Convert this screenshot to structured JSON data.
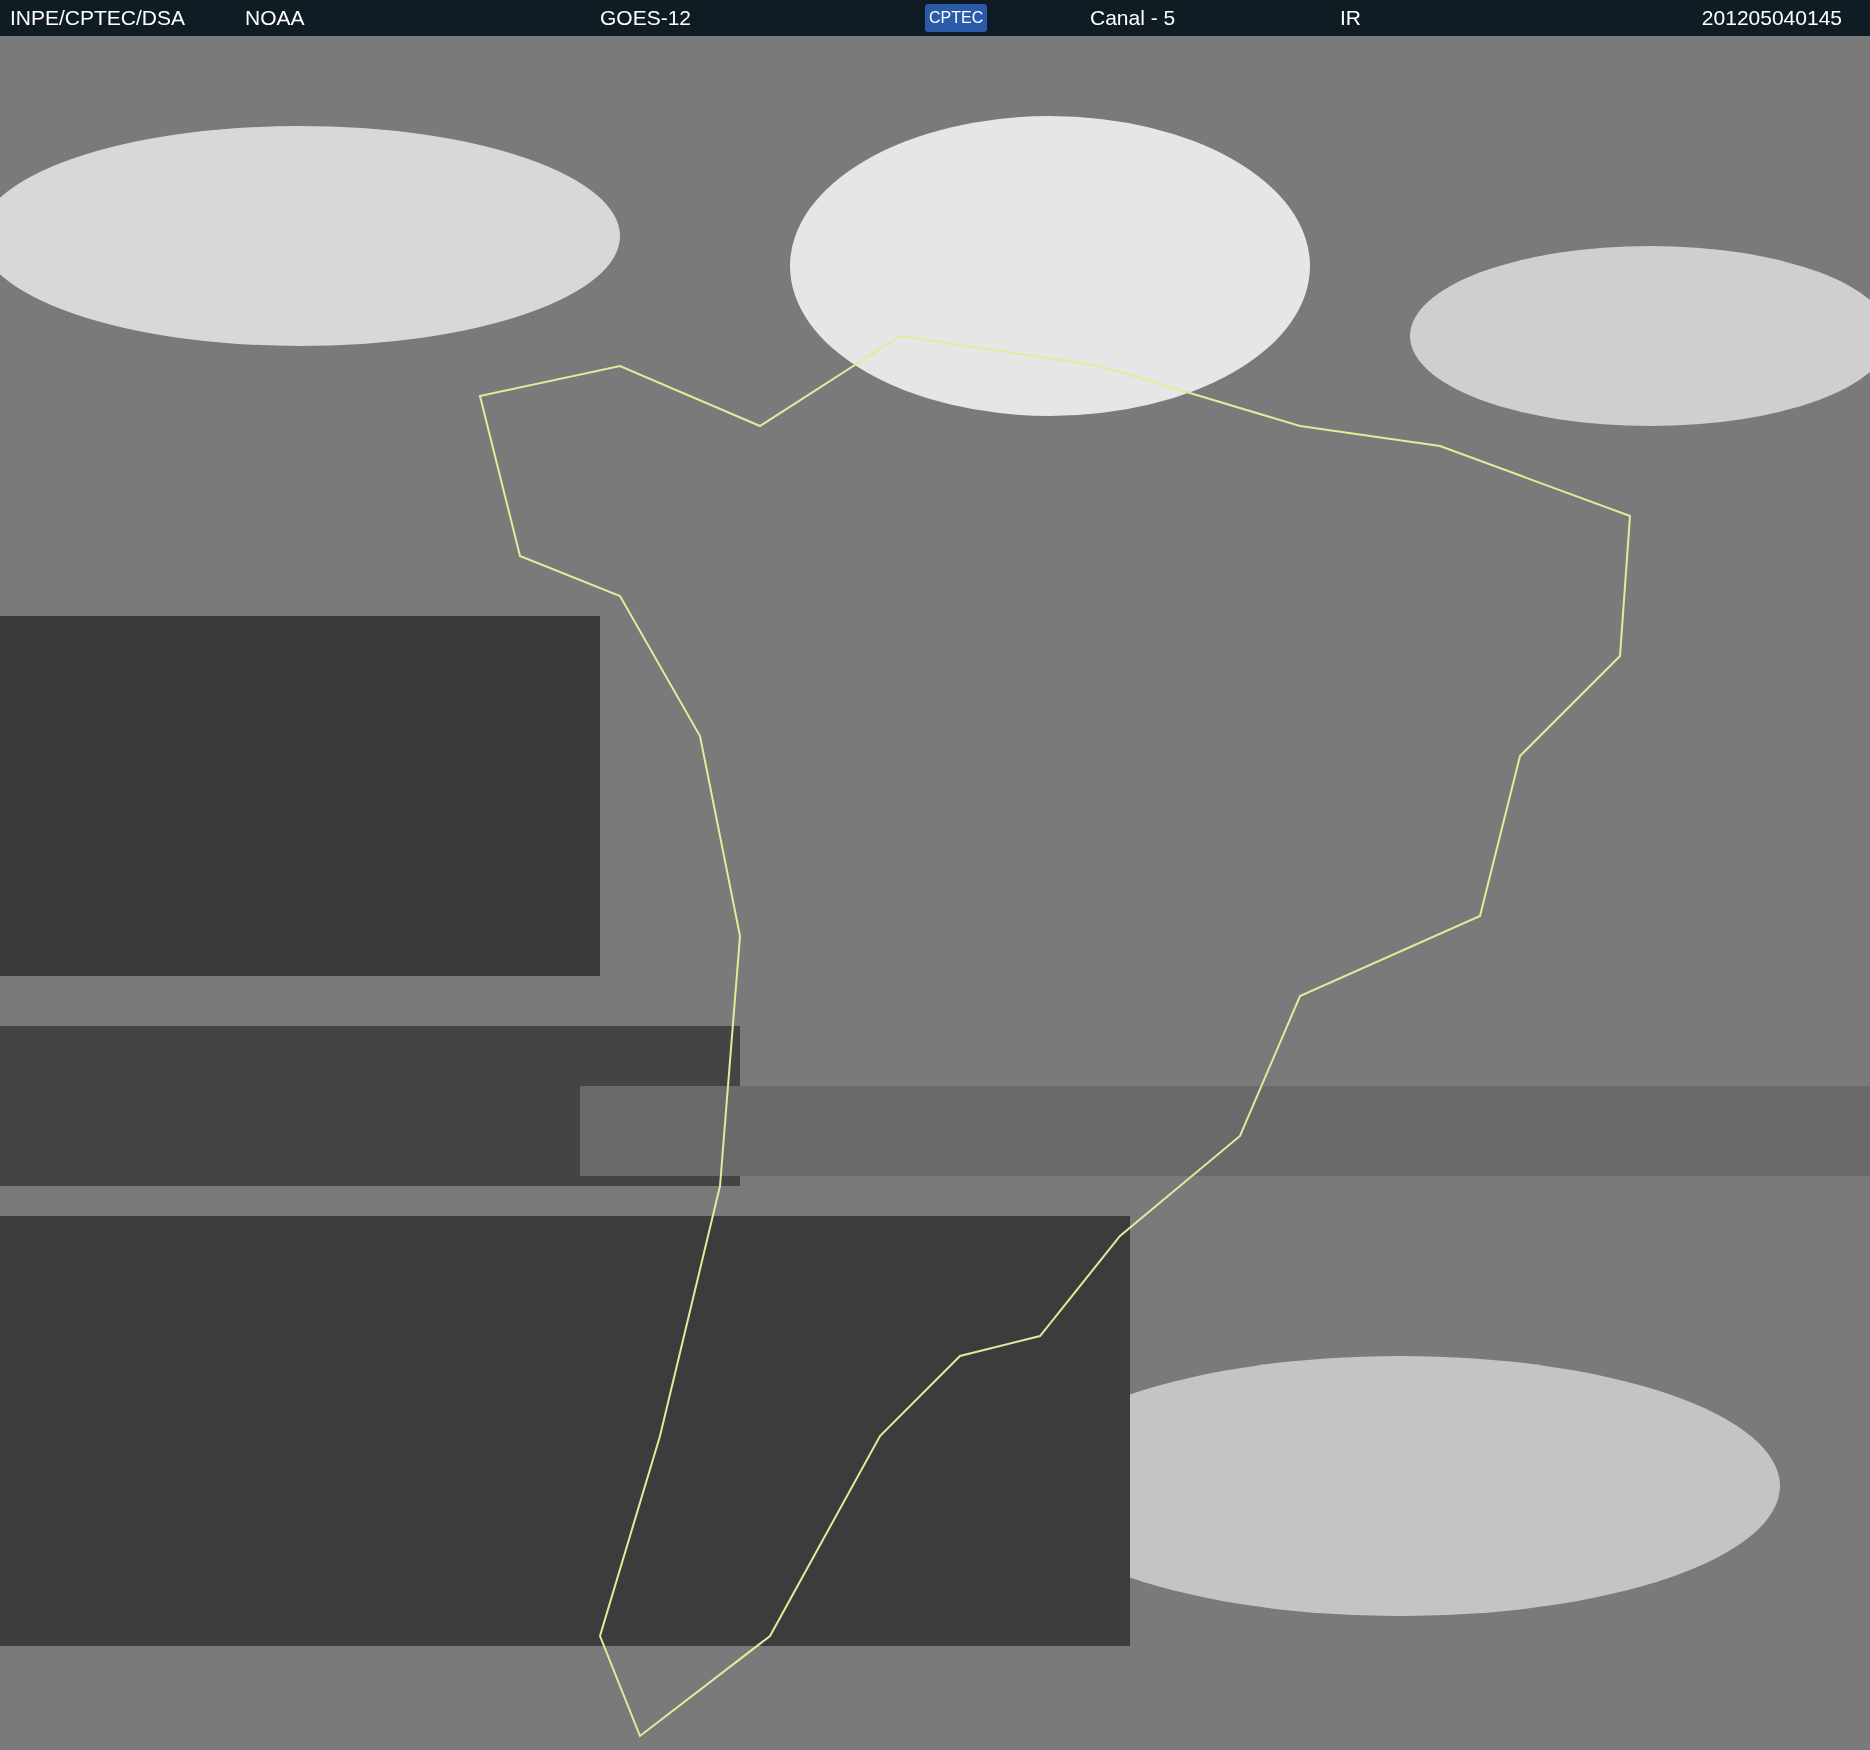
{
  "header": {
    "source": "INPE/CPTEC/DSA",
    "agency": "NOAA",
    "satellite": "GOES-12",
    "logo": "CPTEC",
    "channel": "Canal - 5",
    "band": "IR",
    "timestamp": "201205040145"
  }
}
